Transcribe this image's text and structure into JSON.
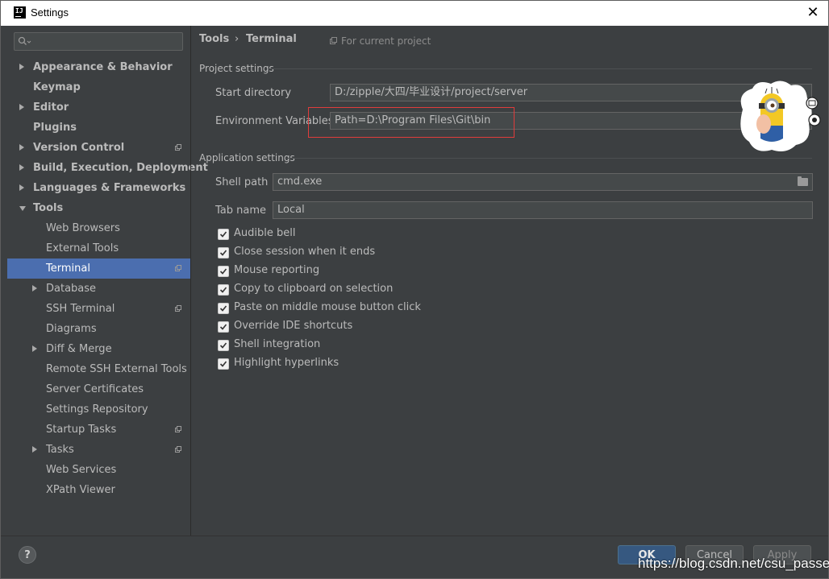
{
  "window": {
    "title": "Settings"
  },
  "sidebar": {
    "items": [
      {
        "label": "Appearance & Behavior",
        "level": 0,
        "arrow": "right",
        "proj": false,
        "selected": false
      },
      {
        "label": "Keymap",
        "level": 0,
        "arrow": "none",
        "proj": false,
        "selected": false
      },
      {
        "label": "Editor",
        "level": 0,
        "arrow": "right",
        "proj": false,
        "selected": false
      },
      {
        "label": "Plugins",
        "level": 0,
        "arrow": "none",
        "proj": false,
        "selected": false
      },
      {
        "label": "Version Control",
        "level": 0,
        "arrow": "right",
        "proj": true,
        "selected": false
      },
      {
        "label": "Build, Execution, Deployment",
        "level": 0,
        "arrow": "right",
        "proj": false,
        "selected": false
      },
      {
        "label": "Languages & Frameworks",
        "level": 0,
        "arrow": "right",
        "proj": false,
        "selected": false
      },
      {
        "label": "Tools",
        "level": 0,
        "arrow": "down",
        "proj": false,
        "selected": false
      },
      {
        "label": "Web Browsers",
        "level": 1,
        "arrow": "none",
        "proj": false,
        "selected": false
      },
      {
        "label": "External Tools",
        "level": 1,
        "arrow": "none",
        "proj": false,
        "selected": false
      },
      {
        "label": "Terminal",
        "level": 1,
        "arrow": "none",
        "proj": true,
        "selected": true
      },
      {
        "label": "Database",
        "level": 1,
        "arrow": "right",
        "proj": false,
        "selected": false
      },
      {
        "label": "SSH Terminal",
        "level": 1,
        "arrow": "none",
        "proj": true,
        "selected": false
      },
      {
        "label": "Diagrams",
        "level": 1,
        "arrow": "none",
        "proj": false,
        "selected": false
      },
      {
        "label": "Diff & Merge",
        "level": 1,
        "arrow": "right",
        "proj": false,
        "selected": false
      },
      {
        "label": "Remote SSH External Tools",
        "level": 1,
        "arrow": "none",
        "proj": false,
        "selected": false
      },
      {
        "label": "Server Certificates",
        "level": 1,
        "arrow": "none",
        "proj": false,
        "selected": false
      },
      {
        "label": "Settings Repository",
        "level": 1,
        "arrow": "none",
        "proj": false,
        "selected": false
      },
      {
        "label": "Startup Tasks",
        "level": 1,
        "arrow": "none",
        "proj": true,
        "selected": false
      },
      {
        "label": "Tasks",
        "level": 1,
        "arrow": "right",
        "proj": true,
        "selected": false
      },
      {
        "label": "Web Services",
        "level": 1,
        "arrow": "none",
        "proj": false,
        "selected": false
      },
      {
        "label": "XPath Viewer",
        "level": 1,
        "arrow": "none",
        "proj": false,
        "selected": false
      }
    ]
  },
  "main": {
    "breadcrumb": {
      "parent": "Tools",
      "separator": "›",
      "current": "Terminal"
    },
    "scope": "For current project",
    "project_settings": {
      "title": "Project settings",
      "start_directory": {
        "label": "Start directory",
        "value": "D:/zipple/大四/毕业设计/project/server"
      },
      "env_vars": {
        "label": "Environment Variables",
        "value": "Path=D:\\Program Files\\Git\\bin"
      }
    },
    "app_settings": {
      "title": "Application settings",
      "shell_path": {
        "label": "Shell path",
        "value": "cmd.exe"
      },
      "tab_name": {
        "label": "Tab name",
        "value": "Local"
      },
      "checkboxes": [
        {
          "label": "Audible bell",
          "checked": true
        },
        {
          "label": "Close session when it ends",
          "checked": true
        },
        {
          "label": "Mouse reporting",
          "checked": true
        },
        {
          "label": "Copy to clipboard on selection",
          "checked": true
        },
        {
          "label": "Paste on middle mouse button click",
          "checked": true
        },
        {
          "label": "Override IDE shortcuts",
          "checked": true
        },
        {
          "label": "Shell integration",
          "checked": true
        },
        {
          "label": "Highlight hyperlinks",
          "checked": true
        }
      ]
    }
  },
  "footer": {
    "help": "?",
    "ok": "OK",
    "cancel": "Cancel",
    "apply": "Apply",
    "watermark": "https://blog.csdn.net/csu_passer"
  },
  "colors": {
    "selection": "#4b6eaf",
    "highlight_box": "#e03c3c",
    "ok_button": "#365880"
  }
}
